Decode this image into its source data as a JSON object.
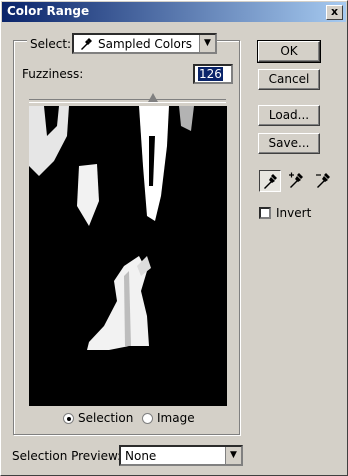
{
  "window": {
    "title": "Color Range",
    "close_label": "x"
  },
  "select": {
    "label": "Select:",
    "value": "Sampled Colors",
    "icon": "eyedropper-icon"
  },
  "fuzziness": {
    "label": "Fuzziness:",
    "value": "126",
    "slider_fraction": 0.63
  },
  "radios": {
    "selection_label": "Selection",
    "image_label": "Image",
    "selected": "Selection"
  },
  "buttons": {
    "ok": "OK",
    "cancel": "Cancel",
    "load": "Load...",
    "save": "Save..."
  },
  "eyedroppers": [
    "eyedropper-icon",
    "eyedropper-plus-icon",
    "eyedropper-minus-icon"
  ],
  "invert": {
    "label": "Invert",
    "checked": false
  },
  "selection_preview": {
    "label": "Selection Preview:",
    "value": "None"
  }
}
